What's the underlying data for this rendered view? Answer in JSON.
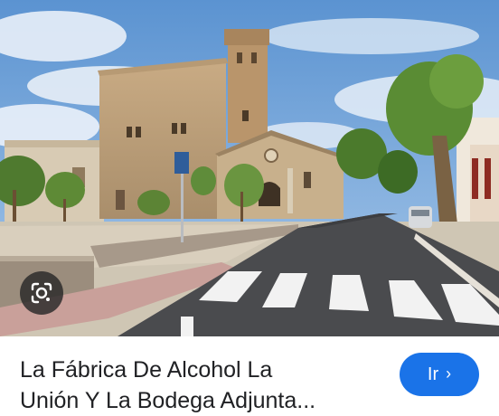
{
  "result": {
    "title": "La Fábrica De Alcohol La\nUnión Y La Bodega Adjunta...",
    "go_button_label": "Ir",
    "go_button_icon": "chevron-right-icon",
    "lens_icon": "google-lens-icon"
  },
  "colors": {
    "accent": "#1a73e8",
    "title_text": "#202124"
  }
}
